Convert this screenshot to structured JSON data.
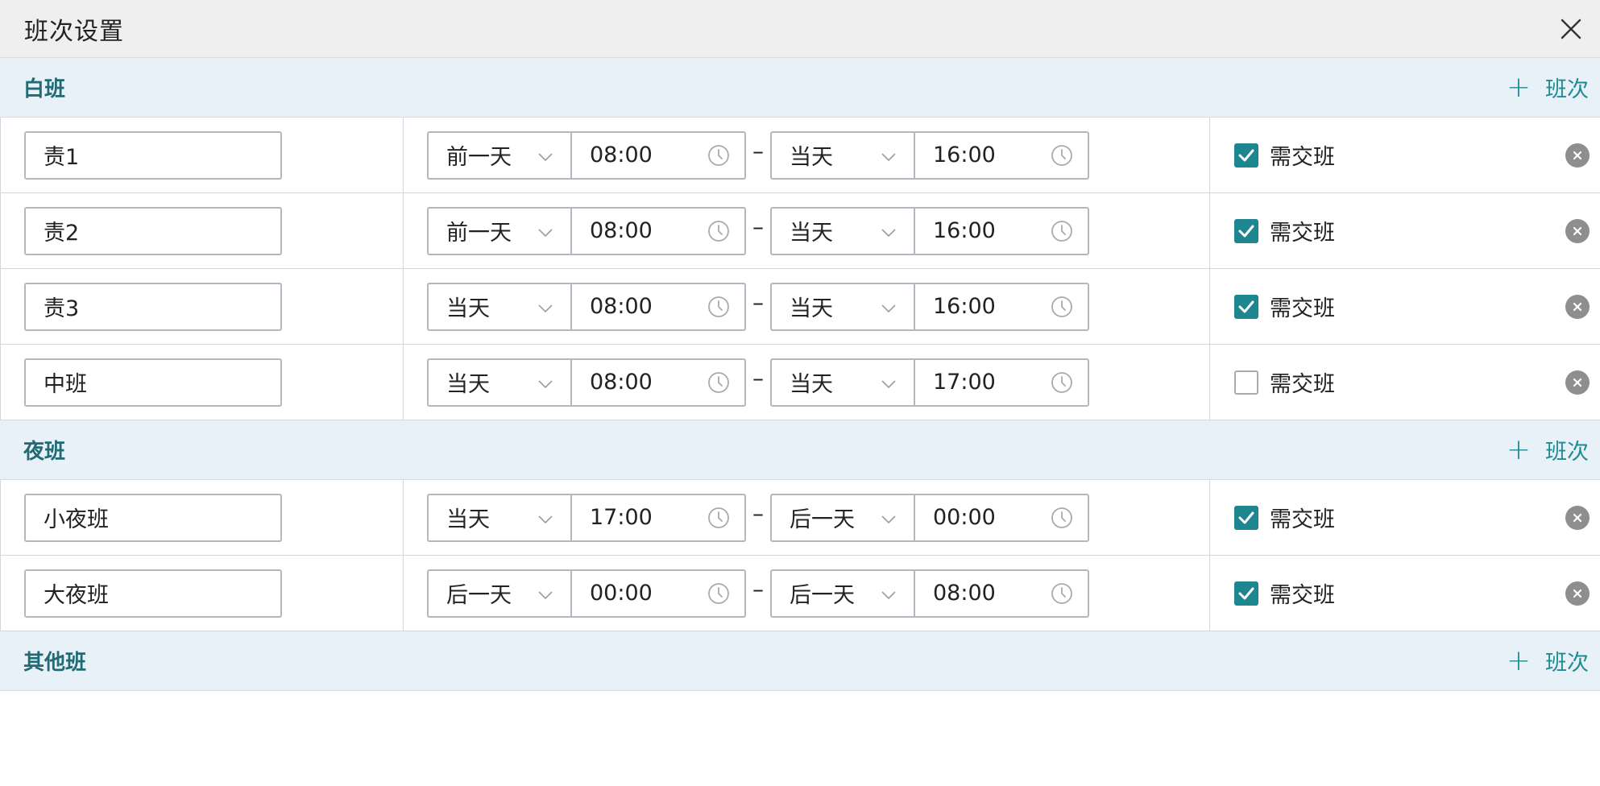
{
  "dialog": {
    "title": "班次设置"
  },
  "add_label": "班次",
  "handover_label": "需交班",
  "accent_color": "#1d868f",
  "groups": [
    {
      "title": "白班",
      "rows": [
        {
          "name": "责1",
          "start_day": "前一天",
          "start_time": "08:00",
          "end_day": "当天",
          "end_time": "16:00",
          "handover": true
        },
        {
          "name": "责2",
          "start_day": "前一天",
          "start_time": "08:00",
          "end_day": "当天",
          "end_time": "16:00",
          "handover": true
        },
        {
          "name": "责3",
          "start_day": "当天",
          "start_time": "08:00",
          "end_day": "当天",
          "end_time": "16:00",
          "handover": true
        },
        {
          "name": "中班",
          "start_day": "当天",
          "start_time": "08:00",
          "end_day": "当天",
          "end_time": "17:00",
          "handover": false
        }
      ]
    },
    {
      "title": "夜班",
      "rows": [
        {
          "name": "小夜班",
          "start_day": "当天",
          "start_time": "17:00",
          "end_day": "后一天",
          "end_time": "00:00",
          "handover": true
        },
        {
          "name": "大夜班",
          "start_day": "后一天",
          "start_time": "00:00",
          "end_day": "后一天",
          "end_time": "08:00",
          "handover": true
        }
      ]
    },
    {
      "title": "其他班",
      "rows": []
    }
  ]
}
